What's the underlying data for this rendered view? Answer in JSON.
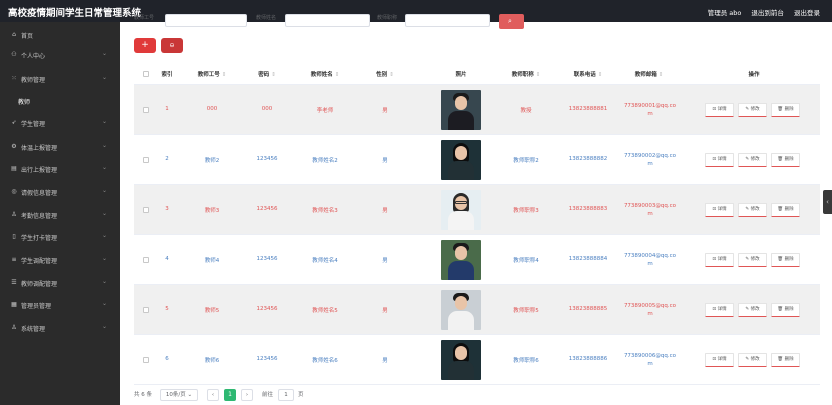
{
  "header": {
    "title": "高校疫情期间学生日常管理系统",
    "user_label": "管理员 abo",
    "to_front_label": "退出到前台",
    "logout_label": "退出登录"
  },
  "sidebar": {
    "items": [
      {
        "icon": "home-icon",
        "label": "首页",
        "expandable": false
      },
      {
        "icon": "user-icon",
        "label": "个人中心",
        "expandable": true
      },
      {
        "icon": "grid-icon",
        "label": "教师管理",
        "expandable": true
      },
      {
        "icon": "",
        "label": "教师",
        "expandable": false,
        "sub": true
      },
      {
        "icon": "send-icon",
        "label": "学生管理",
        "expandable": true
      },
      {
        "icon": "gear-icon",
        "label": "体温上报管理",
        "expandable": true
      },
      {
        "icon": "ticket-icon",
        "label": "出行上报管理",
        "expandable": true
      },
      {
        "icon": "circle-icon",
        "label": "请假信息管理",
        "expandable": true
      },
      {
        "icon": "person-icon",
        "label": "考勤信息管理",
        "expandable": true
      },
      {
        "icon": "phone-icon",
        "label": "学生打卡管理",
        "expandable": true
      },
      {
        "icon": "list-icon",
        "label": "学生调配管理",
        "expandable": true
      },
      {
        "icon": "menu-icon",
        "label": "教师调配管理",
        "expandable": true
      },
      {
        "icon": "folder-icon",
        "label": "管理员管理",
        "expandable": true
      },
      {
        "icon": "person-icon",
        "label": "系统管理",
        "expandable": true
      }
    ]
  },
  "filter": {
    "label_1": "教师工号",
    "label_2": "教师姓名",
    "label_3": "教师职称",
    "search_icon": "search-icon"
  },
  "actions": {
    "add_label": "+",
    "delete_label": "⊖"
  },
  "table": {
    "columns": [
      "索引",
      "教师工号",
      "密码",
      "教师姓名",
      "性别",
      "照片",
      "教师职称",
      "联系电话",
      "教师邮箱",
      "操作"
    ],
    "sort_mark": "⇕",
    "detail_label": "⊡ 详情",
    "edit_label": "✎ 修改",
    "remove_label": "🗑 删除",
    "rows": [
      {
        "index": "1",
        "id": "000",
        "password": "000",
        "name": "李老师",
        "gender": "男",
        "photo": "man-suit",
        "title": "教授",
        "phone": "13823888881",
        "email": "773890001@qq.com"
      },
      {
        "index": "2",
        "id": "教师2",
        "password": "123456",
        "name": "教师姓名2",
        "gender": "男",
        "photo": "woman-dark",
        "title": "教师职称2",
        "phone": "13823888882",
        "email": "773890002@qq.com"
      },
      {
        "index": "3",
        "id": "教师3",
        "password": "123456",
        "name": "教师姓名3",
        "gender": "男",
        "photo": "woman-glasses",
        "title": "教师职称3",
        "phone": "13823888883",
        "email": "773890003@qq.com"
      },
      {
        "index": "4",
        "id": "教师4",
        "password": "123456",
        "name": "教师姓名4",
        "gender": "男",
        "photo": "man-outdoor",
        "title": "教师职称4",
        "phone": "13823888884",
        "email": "773890004@qq.com"
      },
      {
        "index": "5",
        "id": "教师5",
        "password": "123456",
        "name": "教师姓名5",
        "gender": "男",
        "photo": "man-white-shirt",
        "title": "教师职称5",
        "phone": "13823888885",
        "email": "773890005@qq.com"
      },
      {
        "index": "6",
        "id": "教师6",
        "password": "123456",
        "name": "教师姓名6",
        "gender": "男",
        "photo": "woman-dark",
        "title": "教师职称6",
        "phone": "13823888886",
        "email": "773890006@qq.com"
      }
    ]
  },
  "pagination": {
    "total_label": "共 6 条",
    "page_size": "10条/页",
    "current_page": "1",
    "goto_label": "前往",
    "goto_value": "1",
    "page_suffix": "页"
  }
}
